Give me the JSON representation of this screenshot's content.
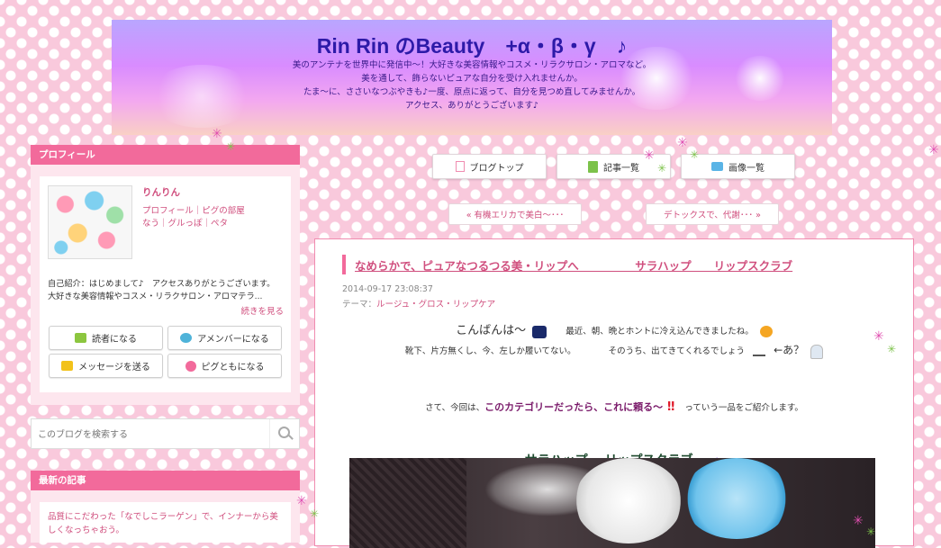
{
  "header": {
    "title": "Rin Rin のBeauty　+α・β・γ　♪",
    "desc_lines": [
      "美のアンテナを世界中に発信中〜！大好きな美容情報やコスメ・リラクサロン・アロマなど。",
      "美を通して、飾らないピュアな自分を受け入れませんか。",
      "たま〜に、ささいなつぶやきも♪一度、原点に返って、自分を見つめ直してみませんか。",
      "アクセス、ありがとうございます♪"
    ]
  },
  "nav": {
    "items": [
      {
        "label": "ブログトップ",
        "icon": "document-icon"
      },
      {
        "label": "記事一覧",
        "icon": "list-icon"
      },
      {
        "label": "画像一覧",
        "icon": "camera-icon"
      }
    ],
    "prev": "« 有機エリカで美白〜･･･",
    "next": "デトックスで、代謝･･･ »"
  },
  "profile": {
    "heading": "プロフィール",
    "name": "りんりん",
    "links_line1": "プロフィール｜ピグの部屋",
    "links_line2": "なう｜グルっぽ｜ペタ",
    "intro": "自己紹介：はじめまして♪　アクセスありがとうございます。 大好きな美容情報やコスメ・リラクサロン・アロマテラ...",
    "more": "続きを見る",
    "buttons": {
      "reader": "読者になる",
      "amember": "アメンバーになる",
      "message": "メッセージを送る",
      "pig": "ピグともになる"
    }
  },
  "search": {
    "placeholder": "このブログを検索する"
  },
  "recent": {
    "heading": "最新の記事",
    "item1": "品質にこだわった「なでしこラーゲン」で、インナーから美しくなっちゃおう。"
  },
  "article": {
    "title": "なめらかで、ピュアなつるつる美・リップへ　　　　　サラハップ　　リップスクラブ",
    "date": "2014-09-17 23:08:37",
    "theme_label": "テーマ：",
    "theme": "ルージュ・グロス・リップケア",
    "greeting": "こんばんは〜",
    "line1_rest": "最近、朝、晩とホントに冷え込んできましたね。",
    "line2a": "靴下、片方無くし、今、左しか履いてない。",
    "line2b": "そのうち、出てきてくれるでしょう",
    "line2c": "←あ？",
    "line3a": "さて、今回は、",
    "line3b": "このカテゴリーだったら、これに頼る〜",
    "line3c": "っていう一品をご紹介します。",
    "product": "サラハップ　 リップスクラブ"
  },
  "colors": {
    "accent": "#f26a9b",
    "link": "#d04f7e",
    "title_blue": "#2d1aa8",
    "product_green": "#1e4a2e",
    "purple_text": "#7a1a6a"
  }
}
